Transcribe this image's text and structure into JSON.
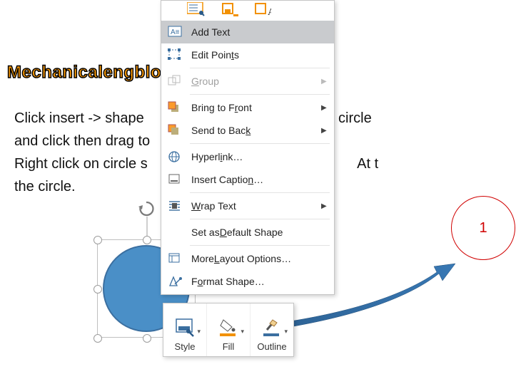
{
  "watermark": "Mechanicalengblog.com",
  "intro": {
    "line1": "Click insert -> shape",
    "line1_tail": "circle",
    "line2": "and click then drag to",
    "line3_a": "Right click on circle s",
    "line3_b": "At t",
    "line4": "the circle."
  },
  "menu": {
    "add_text": "Add Text",
    "edit_points": {
      "pre": "Edit Poin",
      "acc": "t",
      "post": "s"
    },
    "group": {
      "acc": "G",
      "post": "roup"
    },
    "bring_front": {
      "pre": "Bring to F",
      "acc": "r",
      "post": "ont"
    },
    "send_back": {
      "pre": "Send to Bac",
      "acc": "k",
      "post": ""
    },
    "hyperlink": {
      "pre": "Hyperl",
      "acc": "i",
      "post": "nk…"
    },
    "caption": {
      "pre": "Insert Captio",
      "acc": "n",
      "post": "…"
    },
    "wrap": {
      "acc": "W",
      "post": "rap Text"
    },
    "default_shape": {
      "pre": "Set as ",
      "acc": "D",
      "post": "efault Shape"
    },
    "more_layout": {
      "pre": "More ",
      "acc": "L",
      "post": "ayout Options…"
    },
    "format_shape": {
      "pre": "F",
      "acc": "o",
      "post": "rmat Shape…"
    }
  },
  "mini": {
    "style": "Style",
    "fill": "Fill",
    "outline": "Outline"
  },
  "red_label": "1"
}
